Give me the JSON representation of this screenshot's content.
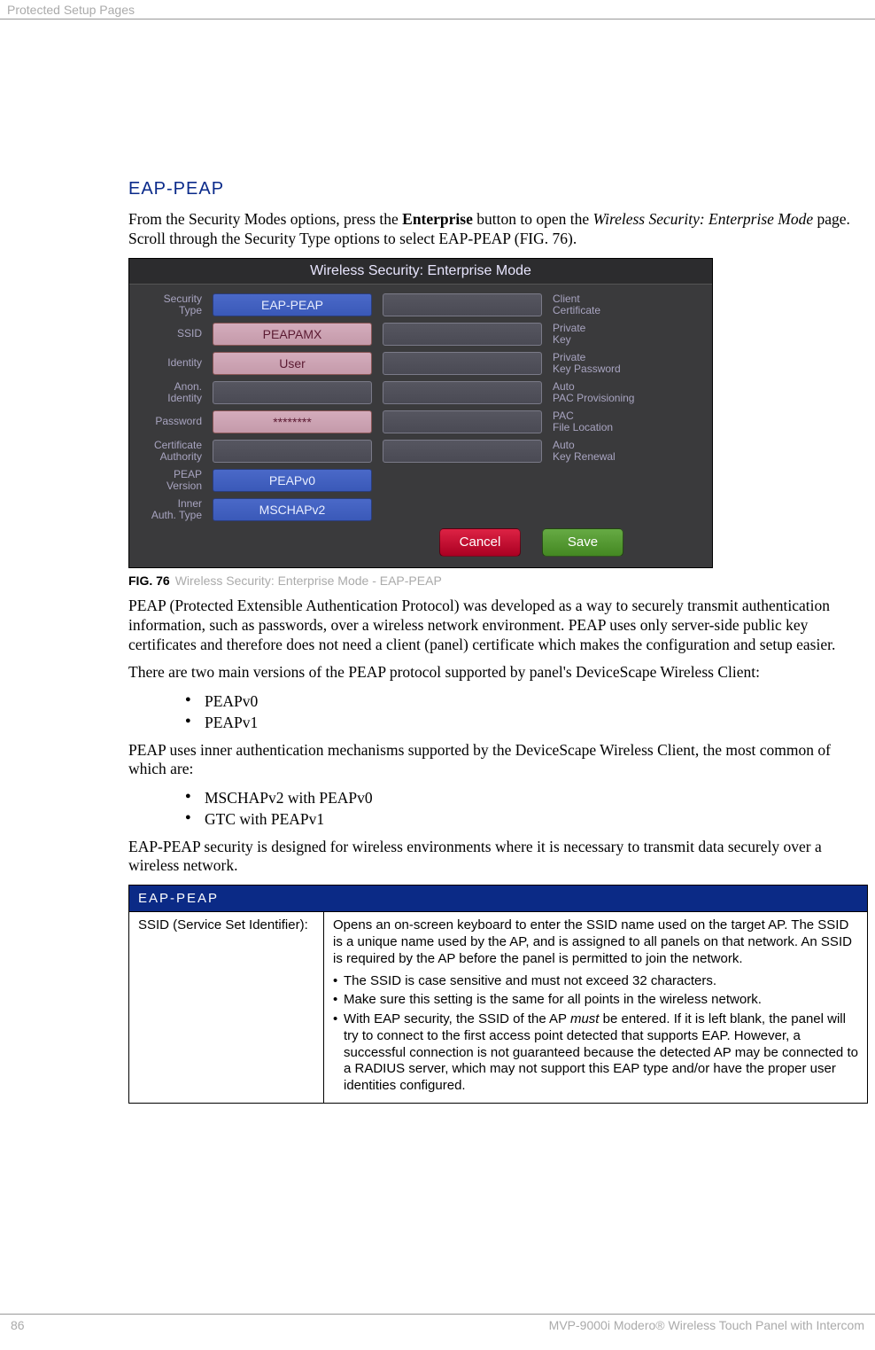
{
  "header": {
    "section": "Protected Setup Pages"
  },
  "title": "EAP-PEAP",
  "intro": {
    "pre": "From the Security Modes options, press the ",
    "bold": "Enterprise",
    "mid": " button to open the ",
    "ital": "Wireless Security: Enterprise Mode",
    "post": " page. Scroll through the Security Type options to select EAP-PEAP (FIG. 76)."
  },
  "shot": {
    "title": "Wireless Security: Enterprise Mode",
    "rows": [
      {
        "ll": "Security Type",
        "lv": "EAP-PEAP",
        "lt": "blue",
        "rv": "",
        "rl": "Client Certificate"
      },
      {
        "ll": "SSID",
        "lv": "PEAPAMX",
        "lt": "pink",
        "rv": "",
        "rl": "Private Key"
      },
      {
        "ll": "Identity",
        "lv": "User",
        "lt": "pink",
        "rv": "",
        "rl": "Private Key Password"
      },
      {
        "ll": "Anon. Identity",
        "lv": "",
        "lt": "grey",
        "rv": "",
        "rl": "Auto PAC Provisioning"
      },
      {
        "ll": "Password",
        "lv": "********",
        "lt": "pink",
        "rv": "",
        "rl": "PAC File Location"
      },
      {
        "ll": "Certificate Authority",
        "lv": "",
        "lt": "grey",
        "rv": "",
        "rl": "Auto Key Renewal"
      },
      {
        "ll": "PEAP Version",
        "lv": "PEAPv0",
        "lt": "blue",
        "rv": null,
        "rl": ""
      },
      {
        "ll": "Inner Auth. Type",
        "lv": "MSCHAPv2",
        "lt": "blue",
        "rv": null,
        "rl": ""
      }
    ],
    "cancel": "Cancel",
    "save": "Save"
  },
  "fig": {
    "num": "FIG. 76",
    "text": "Wireless Security: Enterprise Mode - EAP-PEAP"
  },
  "p2": "PEAP (Protected Extensible Authentication Protocol) was developed as a way to securely transmit authentication information, such as passwords, over a wireless network environment. PEAP uses only server-side public key certificates and therefore does not need a client (panel) certificate which makes the configuration and setup easier.",
  "p3": "There are two main versions of the PEAP protocol supported by panel's DeviceScape Wireless Client:",
  "peap_versions": [
    "PEAPv0",
    "PEAPv1"
  ],
  "p4": "PEAP uses inner authentication mechanisms supported by the DeviceScape Wireless Client, the most common of which are:",
  "inner_auth": [
    "MSCHAPv2 with PEAPv0",
    "GTC with PEAPv1"
  ],
  "p5": "EAP-PEAP security is designed for wireless environments where it is necessary to transmit data securely over a wireless network.",
  "table": {
    "title": "EAP-PEAP",
    "row1_key": "SSID (Service Set Identifier):",
    "row1_desc": "Opens an on-screen keyboard to enter the SSID name used on the target AP. The SSID is a unique name used by the AP, and is assigned to all panels on that network. An SSID is required by the AP before the panel is permitted to join the network.",
    "notes": [
      {
        "text": "The SSID is case sensitive and must not exceed 32 characters."
      },
      {
        "text": "Make sure this setting is the same for all points in the wireless network."
      },
      {
        "pre": "With EAP security, the SSID of the AP ",
        "ital": "must",
        "post": " be entered. If it is left blank, the panel will try to connect to the first access point detected that supports EAP. However, a successful connection is not guaranteed because the detected AP may be connected to a RADIUS server, which may not support this EAP type and/or have the proper user identities configured."
      }
    ]
  },
  "footer": {
    "page": "86",
    "right": "MVP-9000i Modero® Wireless Touch Panel with Intercom"
  }
}
